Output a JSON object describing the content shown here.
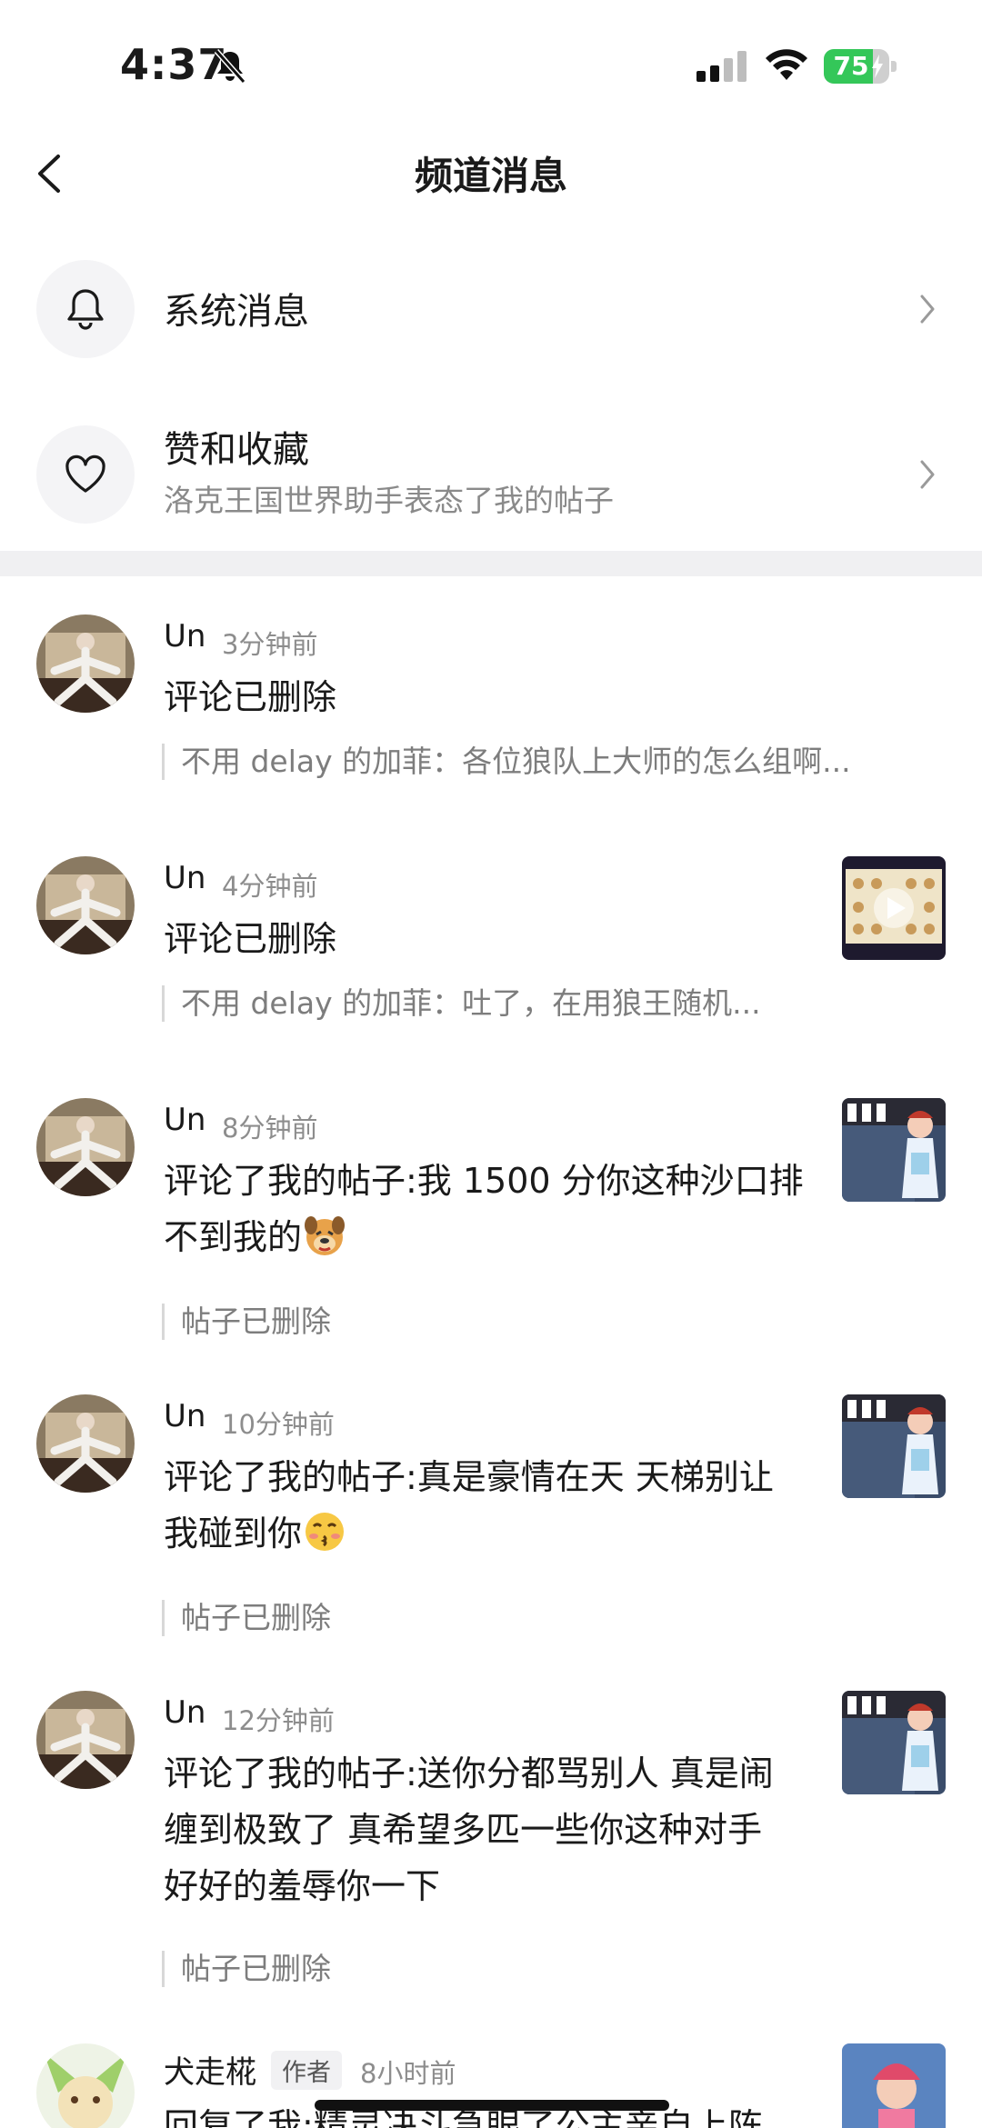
{
  "status_bar": {
    "time": "4:37",
    "battery": "75",
    "battery_level": 0.75
  },
  "header": {
    "title": "频道消息"
  },
  "quick_items": [
    {
      "title": "系统消息",
      "subtitle": "",
      "icon": "bell-icon"
    },
    {
      "title": "赞和收藏",
      "subtitle": "洛克王国世界助手表态了我的帖子",
      "icon": "heart-icon"
    }
  ],
  "feed": [
    {
      "user": "Un",
      "time": "3分钟前",
      "text": "评论已删除",
      "quote": "不用 delay 的加菲：各位狼队上大师的怎么组啊...",
      "thumbnail": ""
    },
    {
      "user": "Un",
      "time": "4分钟前",
      "text": "评论已删除",
      "quote": "不用 delay 的加菲：吐了，在用狼王随机...",
      "thumbnail": "video-thumbnail"
    },
    {
      "user": "Un",
      "time": "8分钟前",
      "text_lines": [
        "评论了我的帖子:我 1500 分你这种沙口排",
        "不到我的"
      ],
      "emoji": "dog-emoji",
      "quote": "帖子已删除",
      "thumbnail": "game-thumbnail"
    },
    {
      "user": "Un",
      "time": "10分钟前",
      "text_lines": [
        "评论了我的帖子:真是豪情在天 天梯别让",
        "我碰到你"
      ],
      "emoji": "kiss-emoji",
      "quote": "帖子已删除",
      "thumbnail": "game-thumbnail"
    },
    {
      "user": "Un",
      "time": "12分钟前",
      "text_lines": [
        "评论了我的帖子:送你分都骂别人 真是闹",
        "缠到极致了 真希望多匹一些你这种对手",
        "好好的羞辱你一下"
      ],
      "quote": "帖子已删除",
      "thumbnail": "game-thumbnail"
    },
    {
      "user": "犬走椛",
      "badge": "作者",
      "time": "8小时前",
      "text": "回复了我:精灵决斗急眼了公主亲自上阵",
      "thumbnail": "game-thumbnail"
    }
  ]
}
